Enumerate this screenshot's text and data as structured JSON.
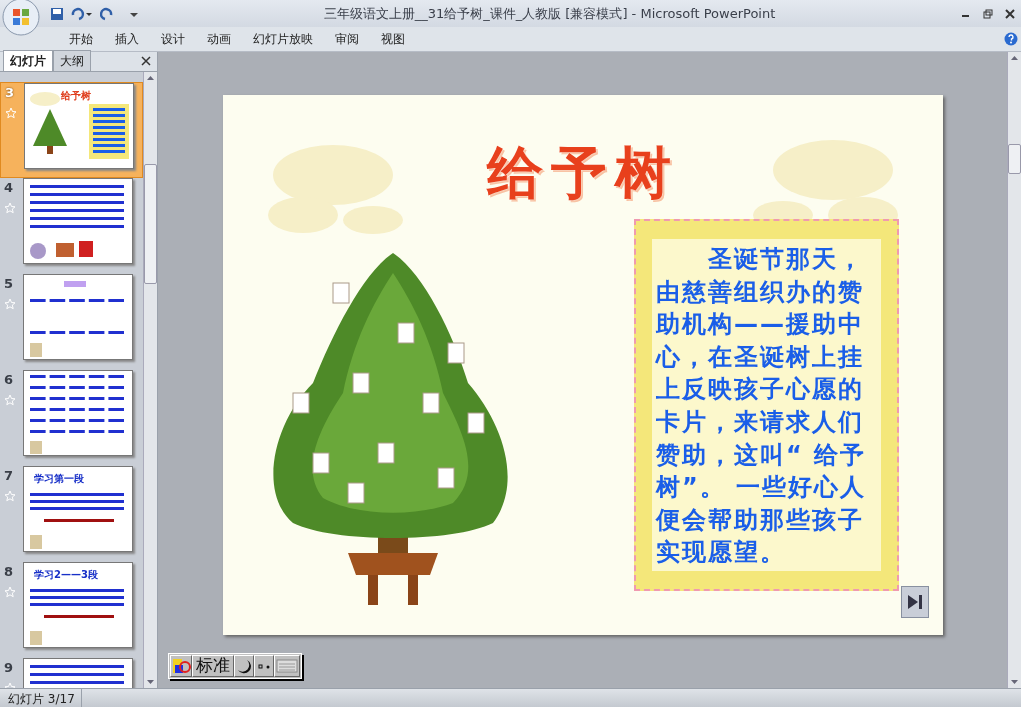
{
  "window": {
    "title": "三年级语文上册__31给予树_课件_人教版 [兼容模式] - Microsoft PowerPoint"
  },
  "ribbon_tabs": [
    {
      "label": "开始"
    },
    {
      "label": "插入"
    },
    {
      "label": "设计"
    },
    {
      "label": "动画"
    },
    {
      "label": "幻灯片放映"
    },
    {
      "label": "审阅"
    },
    {
      "label": "视图"
    }
  ],
  "pane_tabs": [
    {
      "label": "幻灯片",
      "selected": true
    },
    {
      "label": "大纲",
      "selected": false
    }
  ],
  "thumbnails": [
    {
      "number": "3",
      "selected": true,
      "kind": "tree",
      "title": "给予树"
    },
    {
      "number": "4",
      "selected": false,
      "kind": "text"
    },
    {
      "number": "5",
      "selected": false,
      "kind": "pinyin"
    },
    {
      "number": "6",
      "selected": false,
      "kind": "grid"
    },
    {
      "number": "7",
      "selected": false,
      "kind": "section",
      "title": "学习第一段"
    },
    {
      "number": "8",
      "selected": false,
      "kind": "section",
      "title": "学习2——3段"
    },
    {
      "number": "9",
      "selected": false,
      "kind": "text"
    }
  ],
  "slide": {
    "title": "给予树",
    "body": "　　圣诞节那天，由慈善组织办的赞助机构——援助中心，在圣诞树上挂上反映孩子心愿的卡片，来请求人们赞助，这叫“ 给予树”。 一些好心人便会帮助那些孩子实现愿望。"
  },
  "ime": {
    "mode": "标准"
  },
  "status_bar": {
    "slide_indicator": "幻灯片 3/17"
  }
}
